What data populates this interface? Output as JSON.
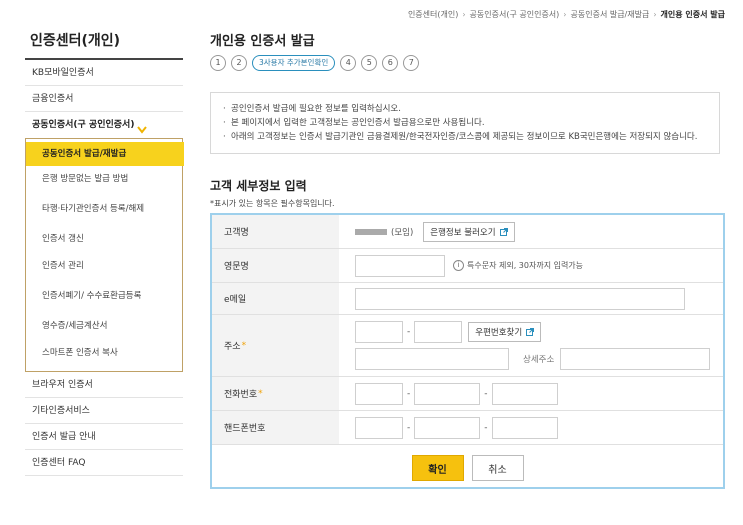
{
  "breadcrumb": [
    "인증센터(개인)",
    "공동인증서(구 공인인증서)",
    "공동인증서 발급/재발급",
    "개인용 인증서 발급"
  ],
  "sidebar": {
    "title": "인증센터(개인)",
    "top_items": [
      "KB모바일인증서",
      "금융인증서"
    ],
    "active_parent": "공동인증서(구 공인인증서)",
    "sub_items": [
      "공동인증서 발급/재발급",
      "은행 방문없는 발급 방법",
      "타행·타기관인증서 등록/해제",
      "인증서 갱신",
      "인증서 관리",
      "인증서폐기/ 수수료환급등록",
      "영수증/세금계산서",
      "스마트폰 인증서 복사"
    ],
    "bottom_items": [
      "브라우저 인증서",
      "기타인증서비스",
      "인증서 발급 안내",
      "인증센터 FAQ"
    ]
  },
  "main": {
    "title": "개인용 인증서 발급",
    "steps": [
      "1",
      "2",
      "3사용자 추가본인확인",
      "4",
      "5",
      "6",
      "7"
    ],
    "current_step": 2,
    "notices": [
      "공인인증서 발급에 필요한 정보를 입력하십시오.",
      "본 페이지에서 입력한 고객정보는 공인인증서 발급용으로만 사용됩니다.",
      "아래의 고객정보는 인증서 발급기관인 금융결제원/한국전자인증/코스콤에 제공되는 정보이므로 KB국민은행에는 저장되지 않습니다."
    ],
    "section_title": "고객 세부정보 입력",
    "required_note": "*표시가 있는 항목은 필수항목입니다."
  },
  "form": {
    "name_label": "고객명",
    "name_suffix": "(모임)",
    "bank_info_button": "은행정보 불러오기",
    "english_name_label": "영문명",
    "english_name_hint": "특수문자 제외, 30자까지 입력가능",
    "email_label": "e메일",
    "address_label": "주소",
    "zipcode_button": "우편번호찾기",
    "detail_address_label": "상세주소",
    "phone_label": "전화번호",
    "mobile_label": "핸드폰번호",
    "required_mark": "*"
  },
  "buttons": {
    "confirm": "확인",
    "cancel": "취소"
  },
  "colors": {
    "accent_yellow": "#f6c10e",
    "form_border": "#9ed0ec",
    "step_active": "#2a8fbd",
    "required_star": "#f0a30a"
  }
}
